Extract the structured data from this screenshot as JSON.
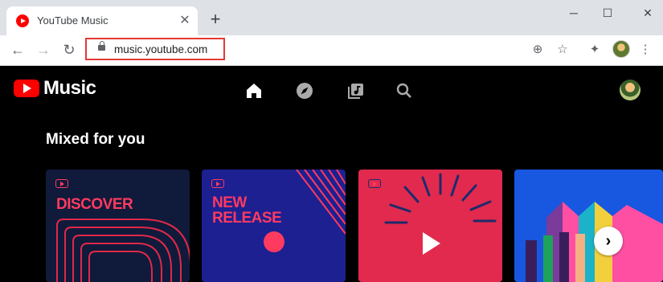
{
  "browser": {
    "tab": {
      "title": "YouTube Music",
      "close": "✕"
    },
    "new_tab": "+",
    "window_controls": {
      "minimize": "─",
      "maximize": "☐",
      "close": "✕"
    },
    "nav": {
      "back": "←",
      "forward": "→",
      "reload": "↻"
    },
    "address_bar": {
      "url": "music.youtube.com"
    },
    "toolbar_icons": {
      "add": "⊕",
      "bookmark": "☆",
      "extensions": "✦",
      "menu": "⋮"
    }
  },
  "app": {
    "logo_text": "Music",
    "section_title": "Mixed for you",
    "cards": [
      {
        "title_line1": "DISCOVER",
        "title_line2": ""
      },
      {
        "title_line1": "NEW",
        "title_line2": "RELEASE"
      },
      {
        "title_line1": "",
        "title_line2": ""
      },
      {
        "title_line1": "",
        "title_line2": ""
      }
    ],
    "carousel_next": "›"
  },
  "colors": {
    "accent_red": "#ff0000",
    "card_pink": "#ff3a60",
    "card1_bg": "#101a3a",
    "card2_bg": "#1c2091",
    "card3_bg": "#e12a4e",
    "card4_bg": "#1857e0"
  },
  "icons": [
    "home-icon",
    "explore-icon",
    "library-icon",
    "search-icon"
  ]
}
